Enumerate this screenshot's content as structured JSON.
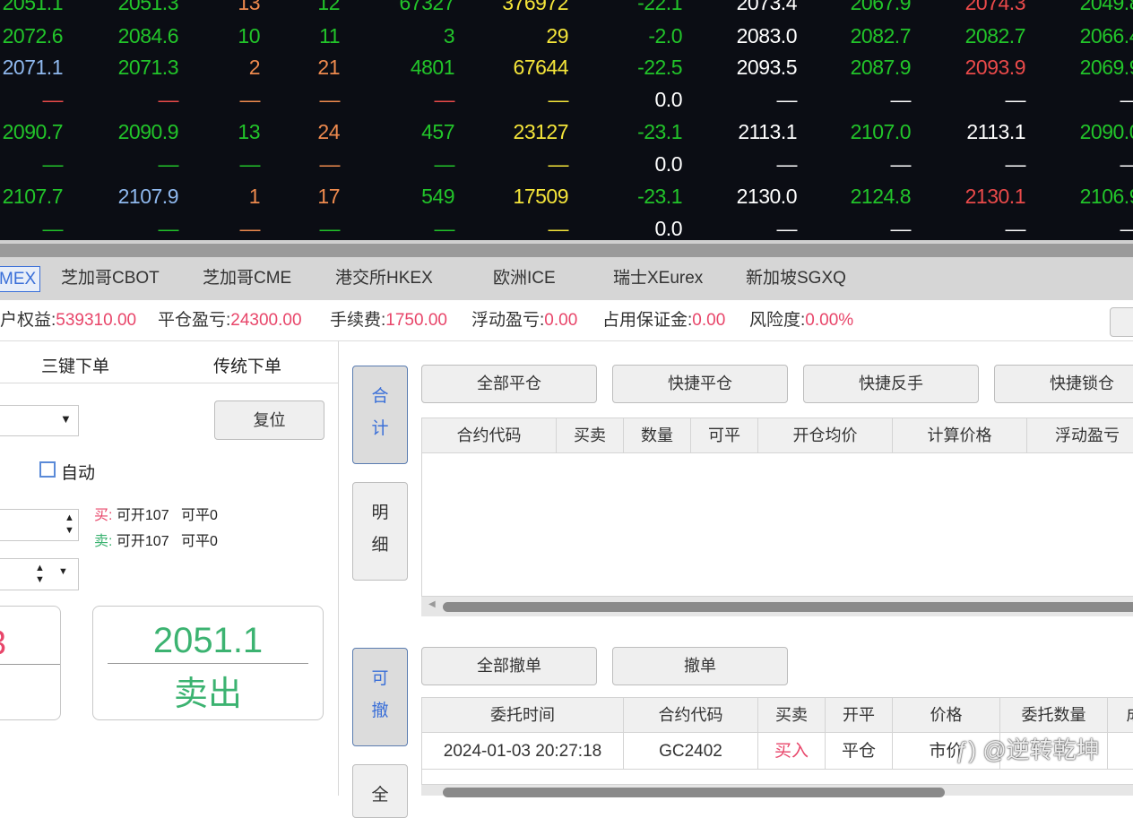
{
  "colors": {
    "g": "#22c42a",
    "o": "#ee8a4e",
    "y": "#f5e53a",
    "b": "#8fb8ee",
    "r": "#ea4a4a",
    "w": "#ffffff",
    "accent": "#3a6fd8",
    "up": "#e8466a",
    "down": "#3cb371"
  },
  "quotes": {
    "rows": [
      [
        [
          "2051.1",
          "g"
        ],
        [
          "2051.3",
          "g"
        ],
        [
          "13",
          "o"
        ],
        [
          "12",
          "g"
        ],
        [
          "67327",
          "g"
        ],
        [
          "376972",
          "y"
        ],
        [
          "-22.1",
          "g"
        ],
        [
          "2073.4",
          "w"
        ],
        [
          "2067.9",
          "g"
        ],
        [
          "2074.3",
          "r"
        ],
        [
          "2049.8",
          "g"
        ]
      ],
      [
        [
          "2072.6",
          "g"
        ],
        [
          "2084.6",
          "g"
        ],
        [
          "10",
          "g"
        ],
        [
          "11",
          "g"
        ],
        [
          "3",
          "g"
        ],
        [
          "29",
          "y"
        ],
        [
          "-2.0",
          "g"
        ],
        [
          "2083.0",
          "w"
        ],
        [
          "2082.7",
          "g"
        ],
        [
          "2082.7",
          "g"
        ],
        [
          "2066.4",
          "g"
        ]
      ],
      [
        [
          "2071.1",
          "b"
        ],
        [
          "2071.3",
          "g"
        ],
        [
          "2",
          "o"
        ],
        [
          "21",
          "o"
        ],
        [
          "4801",
          "g"
        ],
        [
          "67644",
          "y"
        ],
        [
          "-22.5",
          "g"
        ],
        [
          "2093.5",
          "w"
        ],
        [
          "2087.9",
          "g"
        ],
        [
          "2093.9",
          "r"
        ],
        [
          "2069.9",
          "g"
        ]
      ],
      [
        [
          "—",
          "r"
        ],
        [
          "—",
          "r"
        ],
        [
          "—",
          "o"
        ],
        [
          "—",
          "o"
        ],
        [
          "—",
          "r"
        ],
        [
          "—",
          "y"
        ],
        [
          "0.0",
          "w"
        ],
        [
          "—",
          "w"
        ],
        [
          "—",
          "w"
        ],
        [
          "—",
          "w"
        ],
        [
          "—",
          "w"
        ]
      ],
      [
        [
          "2090.7",
          "g"
        ],
        [
          "2090.9",
          "g"
        ],
        [
          "13",
          "g"
        ],
        [
          "24",
          "o"
        ],
        [
          "457",
          "g"
        ],
        [
          "23127",
          "y"
        ],
        [
          "-23.1",
          "g"
        ],
        [
          "2113.1",
          "w"
        ],
        [
          "2107.0",
          "g"
        ],
        [
          "2113.1",
          "w"
        ],
        [
          "2090.0",
          "g"
        ]
      ],
      [
        [
          "—",
          "g"
        ],
        [
          "—",
          "g"
        ],
        [
          "—",
          "g"
        ],
        [
          "—",
          "o"
        ],
        [
          "—",
          "g"
        ],
        [
          "—",
          "y"
        ],
        [
          "0.0",
          "w"
        ],
        [
          "—",
          "w"
        ],
        [
          "—",
          "w"
        ],
        [
          "—",
          "w"
        ],
        [
          "—",
          "w"
        ]
      ],
      [
        [
          "2107.7",
          "g"
        ],
        [
          "2107.9",
          "b"
        ],
        [
          "1",
          "o"
        ],
        [
          "17",
          "o"
        ],
        [
          "549",
          "g"
        ],
        [
          "17509",
          "y"
        ],
        [
          "-23.1",
          "g"
        ],
        [
          "2130.0",
          "w"
        ],
        [
          "2124.8",
          "g"
        ],
        [
          "2130.1",
          "r"
        ],
        [
          "2106.9",
          "g"
        ]
      ],
      [
        [
          "—",
          "g"
        ],
        [
          "—",
          "g"
        ],
        [
          "—",
          "o"
        ],
        [
          "—",
          "g"
        ],
        [
          "—",
          "g"
        ],
        [
          "—",
          "y"
        ],
        [
          "0.0",
          "w"
        ],
        [
          "—",
          "w"
        ],
        [
          "—",
          "w"
        ],
        [
          "—",
          "w"
        ],
        [
          "—",
          "w"
        ]
      ]
    ]
  },
  "exchange_tabs": [
    "MEX",
    "芝加哥CBOT",
    "芝加哥CME",
    "港交所HKEX",
    "欧洲ICE",
    "瑞士XEurex",
    "新加坡SGXQ"
  ],
  "account": [
    {
      "label": "户权益:",
      "value": "539310.00"
    },
    {
      "label": "平仓盈亏:",
      "value": "24300.00"
    },
    {
      "label": "手续费:",
      "value": "1750.00"
    },
    {
      "label": "浮动盈亏:",
      "value": "0.00"
    },
    {
      "label": "占用保证金:",
      "value": "0.00"
    },
    {
      "label": "风险度:",
      "value": "0.00%"
    }
  ],
  "order_panel": {
    "tabs": [
      "三键下单",
      "传统下单"
    ],
    "reset": "复位",
    "auto": "自动",
    "buy_label": "买:",
    "buy_info": "可开107   可平0",
    "sell_label": "卖:",
    "sell_info": "可开107   可平0",
    "sell_price": "2051.1",
    "sell_action": "卖出",
    "buy_price_partial": "3"
  },
  "positions": {
    "side_tabs": [
      "合计",
      "明细"
    ],
    "buttons": [
      "全部平仓",
      "快捷平仓",
      "快捷反手",
      "快捷锁仓"
    ],
    "columns": [
      "合约代码",
      "买卖",
      "数量",
      "可平",
      "开仓均价",
      "计算价格",
      "浮动盈亏"
    ]
  },
  "orders": {
    "side_tabs": [
      "可撤",
      "全"
    ],
    "buttons": [
      "全部撤单",
      "撤单"
    ],
    "columns": [
      "委托时间",
      "合约代码",
      "买卖",
      "开平",
      "价格",
      "委托数量",
      "成"
    ],
    "rows": [
      [
        "2024-01-03 20:27:18",
        "GC2402",
        "买入",
        "平仓",
        "市价",
        "",
        ""
      ]
    ]
  },
  "watermark": "@逆转乾坤"
}
